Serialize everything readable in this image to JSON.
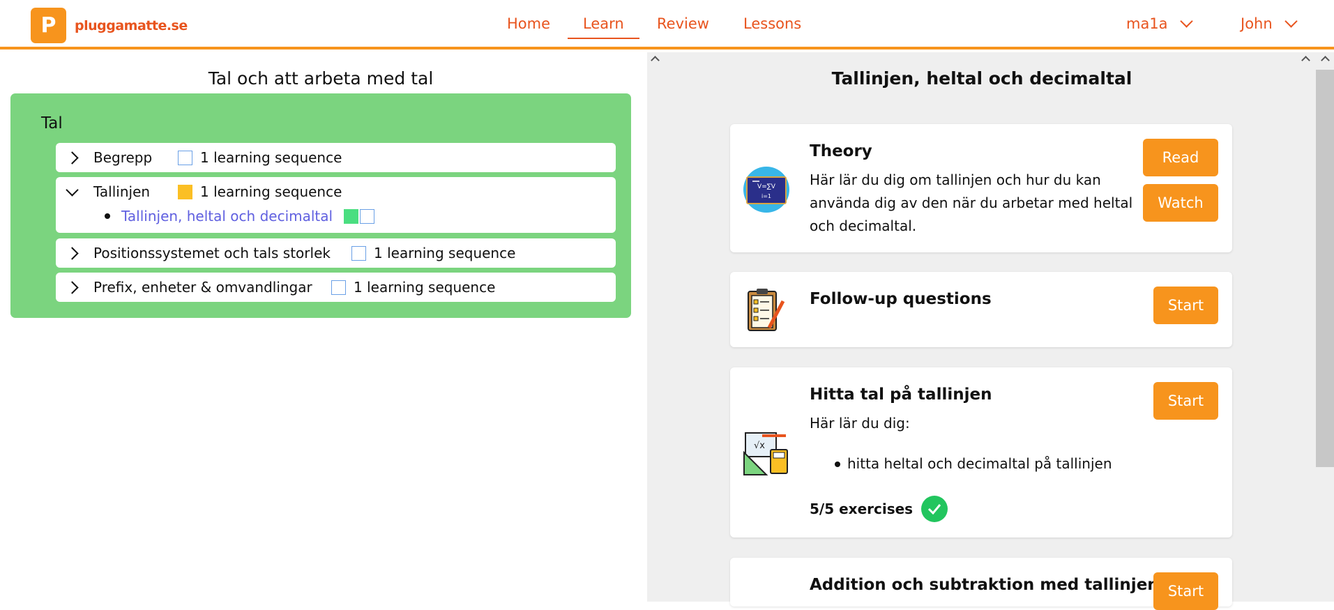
{
  "header": {
    "logo_letter": "P",
    "logo_text": "pluggamatte.se",
    "nav": [
      {
        "label": "Home"
      },
      {
        "label": "Learn",
        "active": true
      },
      {
        "label": "Review"
      },
      {
        "label": "Lessons"
      }
    ],
    "course_menu": "ma1a",
    "user_menu": "John"
  },
  "left": {
    "title": "Tal och att arbeta med tal",
    "section_label": "Tal",
    "rows": [
      {
        "label": "Begrepp",
        "seq": "1 learning sequence",
        "status": "empty",
        "expanded": false
      },
      {
        "label": "Tallinjen",
        "seq": "1 learning sequence",
        "status": "yellow",
        "expanded": true,
        "children": [
          {
            "label": "Tallinjen, heltal och decimaltal"
          }
        ]
      },
      {
        "label": "Positionssystemet och tals storlek",
        "seq": "1 learning sequence",
        "status": "empty",
        "expanded": false
      },
      {
        "label": "Prefix, enheter & omvandlingar",
        "seq": "1 learning sequence",
        "status": "empty",
        "expanded": false
      }
    ]
  },
  "right": {
    "title": "Tallinjen, heltal och decimaltal",
    "cards": [
      {
        "title": "Theory",
        "icon": "blackboard-icon",
        "text_lines": [
          "Här lär du dig om tallinjen och hur du kan",
          "använda dig av den när du arbetar med heltal",
          "och decimaltal."
        ],
        "buttons": [
          "Read",
          "Watch"
        ]
      },
      {
        "title": "Follow-up questions",
        "icon": "clipboard-icon",
        "buttons": [
          "Start"
        ]
      },
      {
        "title": "Hitta tal på tallinjen",
        "icon": "math-tools-icon",
        "intro": "Här lär du dig:",
        "bullets": [
          "hitta heltal och decimaltal på tallinjen"
        ],
        "progress": "5/5 exercises",
        "progress_fraction": 1.0,
        "buttons": [
          "Start"
        ]
      },
      {
        "title": "Addition och subtraktion med tallinjen",
        "buttons": [
          "Start"
        ]
      }
    ]
  },
  "colors": {
    "brand_orange": "#f7941d",
    "nav_red": "#e8541e",
    "green_panel": "#7bd47f",
    "link_purple": "#6060e0",
    "done_green": "#22c55e"
  }
}
